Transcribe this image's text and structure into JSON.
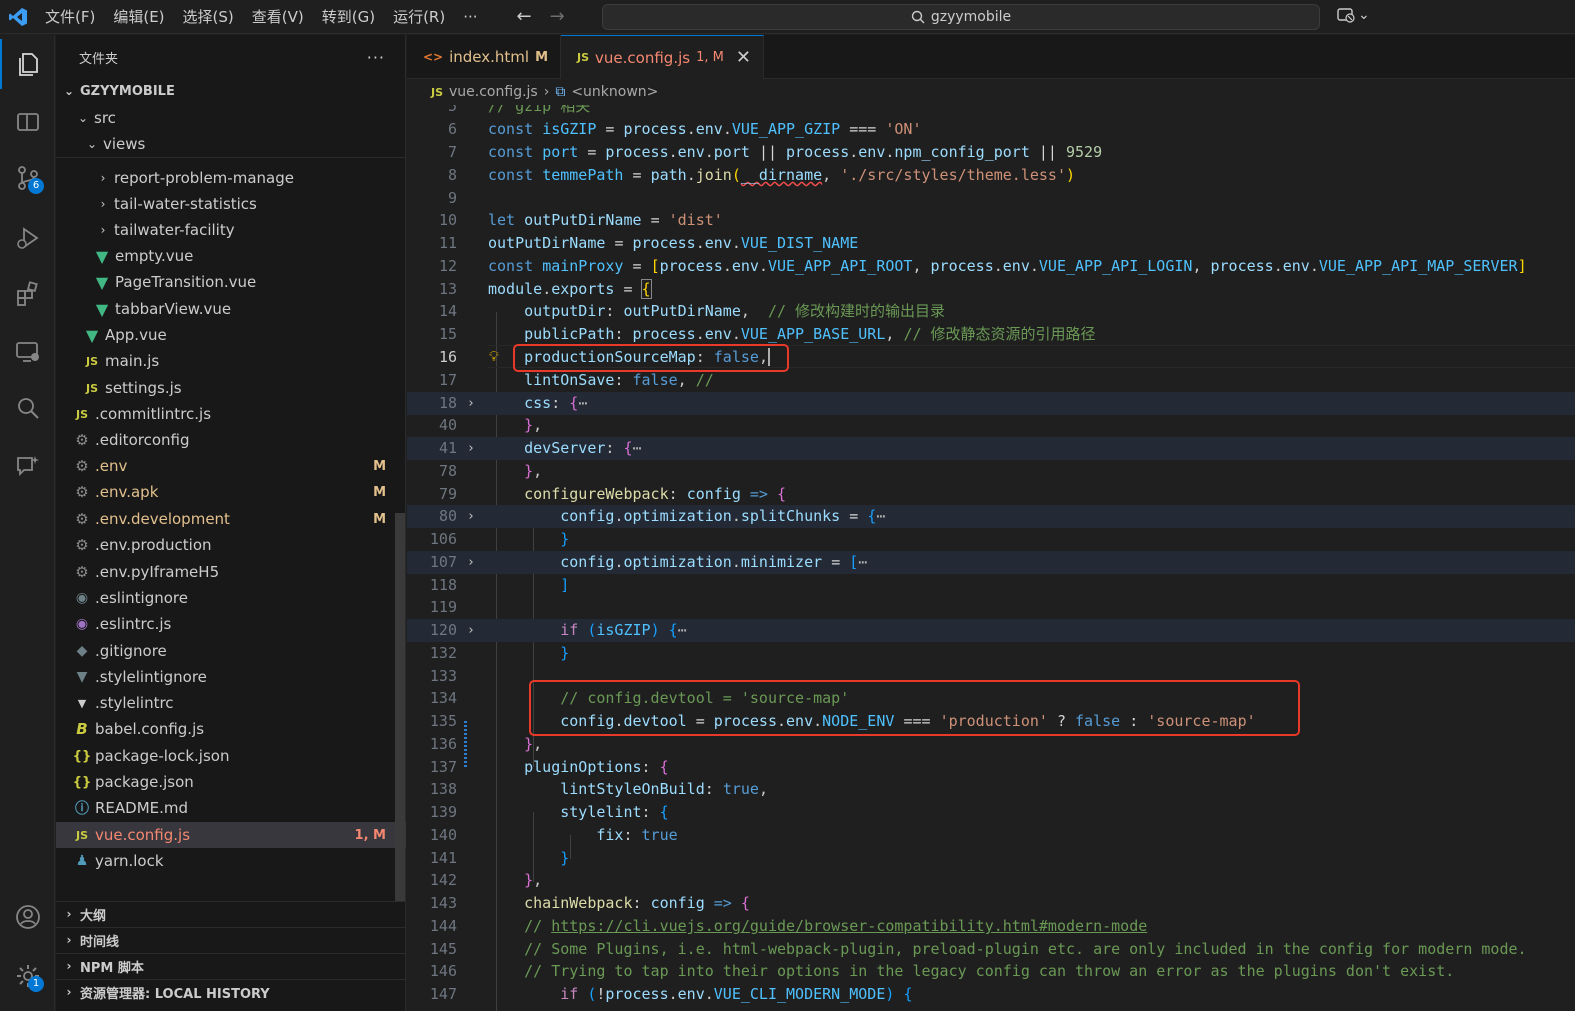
{
  "titlebar": {
    "menu": [
      "文件(F)",
      "编辑(E)",
      "选择(S)",
      "查看(V)",
      "转到(G)",
      "运行(R)",
      "···"
    ],
    "search_text": "gzyymobile"
  },
  "activity": {
    "scm_badge": "6",
    "settings_badge": "1"
  },
  "sidebar": {
    "header": "文件夹",
    "more": "···",
    "root": "GZYYMOBILE",
    "items": [
      {
        "label": "src"
      },
      {
        "label": "views"
      },
      {
        "label": "report-problem-manage"
      },
      {
        "label": "tail-water-statistics"
      },
      {
        "label": "tailwater-facility"
      },
      {
        "label": "empty.vue"
      },
      {
        "label": "PageTransition.vue"
      },
      {
        "label": "tabbarView.vue"
      },
      {
        "label": "App.vue"
      },
      {
        "label": "main.js"
      },
      {
        "label": "settings.js"
      },
      {
        "label": ".commitlintrc.js"
      },
      {
        "label": ".editorconfig"
      },
      {
        "label": ".env",
        "status": "M"
      },
      {
        "label": ".env.apk",
        "status": "M"
      },
      {
        "label": ".env.development",
        "status": "M"
      },
      {
        "label": ".env.production"
      },
      {
        "label": ".env.pyIframeH5"
      },
      {
        "label": ".eslintignore"
      },
      {
        "label": ".eslintrc.js"
      },
      {
        "label": ".gitignore"
      },
      {
        "label": ".stylelintignore"
      },
      {
        "label": ".stylelintrc"
      },
      {
        "label": "babel.config.js"
      },
      {
        "label": "package-lock.json"
      },
      {
        "label": "package.json"
      },
      {
        "label": "README.md"
      },
      {
        "label": "vue.config.js",
        "status": "1, M"
      },
      {
        "label": "yarn.lock"
      }
    ],
    "sections": [
      "大纲",
      "时间线",
      "NPM 脚本",
      "资源管理器: LOCAL HISTORY"
    ]
  },
  "editor": {
    "tabs": [
      {
        "icon": "<>",
        "label": "index.html",
        "status": "M"
      },
      {
        "icon": "JS",
        "label": "vue.config.js",
        "status": "1, M",
        "close": "✕"
      }
    ],
    "breadcrumb": {
      "icon": "JS",
      "file": "vue.config.js",
      "symbol": "<unknown>"
    },
    "line_numbers": [
      "5",
      "6",
      "7",
      "8",
      "9",
      "10",
      "11",
      "12",
      "13",
      "14",
      "15",
      "16",
      "17",
      "18",
      "40",
      "41",
      "78",
      "79",
      "80",
      "106",
      "107",
      "118",
      "119",
      "120",
      "132",
      "133",
      "134",
      "135",
      "136",
      "137",
      "138",
      "139",
      "140",
      "141",
      "142",
      "143",
      "144",
      "145",
      "146",
      "147"
    ]
  },
  "colors": {
    "accent": "#0078d4",
    "highlight_box": "#e8392a",
    "modified": "#e2c08d"
  }
}
